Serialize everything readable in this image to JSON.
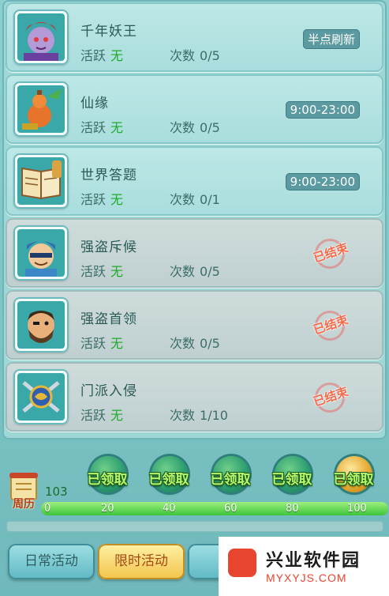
{
  "activities": [
    {
      "name": "千年妖王",
      "active_label": "活跃",
      "active_value": "无",
      "count_label": "次数",
      "count_value": "0/5",
      "status": "半点刷新",
      "ended": false,
      "icon": "demon-king-icon"
    },
    {
      "name": "仙缘",
      "active_label": "活跃",
      "active_value": "无",
      "count_label": "次数",
      "count_value": "0/5",
      "status": "9:00-23:00",
      "ended": false,
      "icon": "fortune-gourd-icon"
    },
    {
      "name": "世界答题",
      "active_label": "活跃",
      "active_value": "无",
      "count_label": "次数",
      "count_value": "0/1",
      "status": "9:00-23:00",
      "ended": false,
      "icon": "quiz-book-icon"
    },
    {
      "name": "强盗斥候",
      "active_label": "活跃",
      "active_value": "无",
      "count_label": "次数",
      "count_value": "0/5",
      "status": "已结束",
      "ended": true,
      "icon": "bandit-scout-icon"
    },
    {
      "name": "强盗首领",
      "active_label": "活跃",
      "active_value": "无",
      "count_label": "次数",
      "count_value": "0/5",
      "status": "已结束",
      "ended": true,
      "icon": "bandit-chief-icon"
    },
    {
      "name": "门派入侵",
      "active_label": "活跃",
      "active_value": "无",
      "count_label": "次数",
      "count_value": "1/10",
      "status": "已结束",
      "ended": true,
      "icon": "sect-invasion-icon"
    }
  ],
  "rewards": {
    "calendar_label": "周历",
    "points_total": "103",
    "progress_fraction": 1.0,
    "ticks": [
      "0",
      "20",
      "40",
      "60",
      "80",
      "100"
    ],
    "badges": [
      {
        "label": "已领取",
        "threshold": 20,
        "style": "green"
      },
      {
        "label": "已领取",
        "threshold": 40,
        "style": "green"
      },
      {
        "label": "已领取",
        "threshold": 60,
        "style": "green"
      },
      {
        "label": "已领取",
        "threshold": 80,
        "style": "green"
      },
      {
        "label": "已领取",
        "threshold": 100,
        "style": "gold"
      }
    ]
  },
  "tabs": [
    {
      "label": "日常活动",
      "selected": false
    },
    {
      "label": "限时活动",
      "selected": true
    },
    {
      "label": "副",
      "selected": false
    }
  ],
  "watermark": {
    "title": "兴业软件园",
    "url": "MYXYJS.COM"
  },
  "colors": {
    "accent_green": "#1faa2a",
    "ended_red": "#f46a4a",
    "selected_tab": "#f2c34a"
  }
}
